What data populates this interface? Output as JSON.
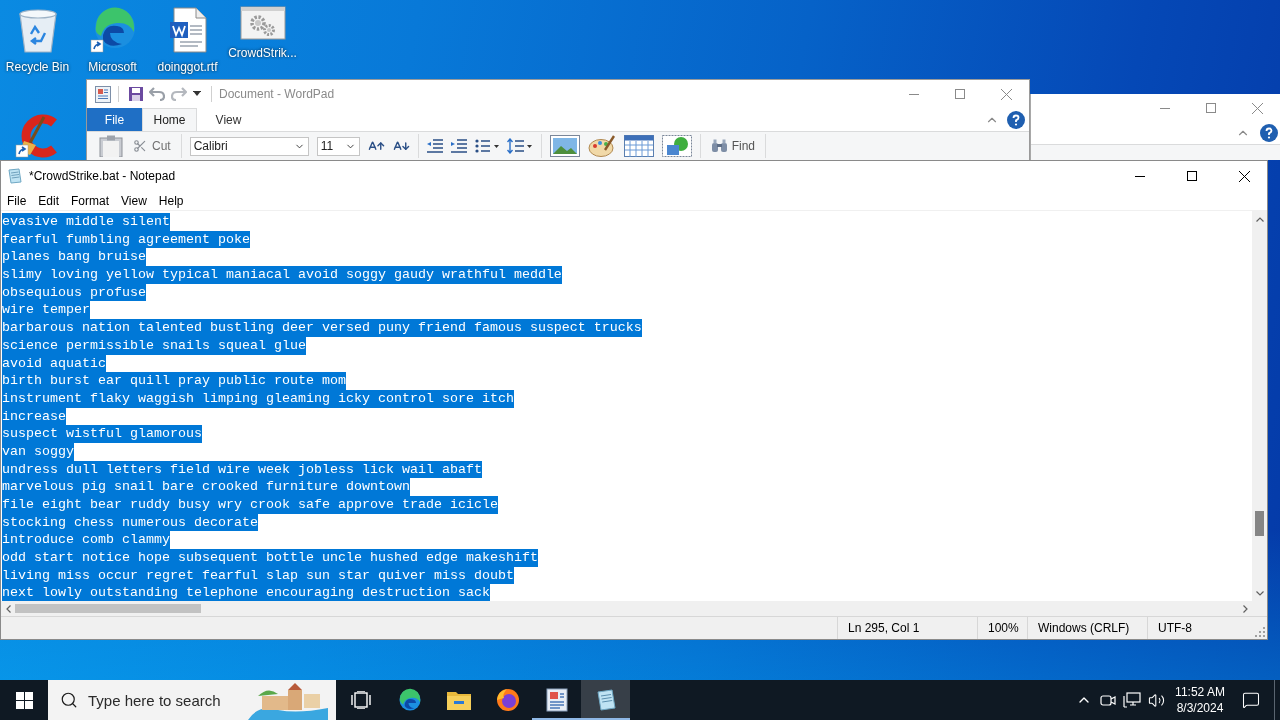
{
  "desktop": {
    "icons": [
      {
        "kind": "recycle-bin",
        "label": "Recycle Bin"
      },
      {
        "kind": "browser",
        "label": "Microsoft"
      },
      {
        "kind": "document",
        "label": "doinggot.rtf"
      },
      {
        "kind": "batch-file",
        "label": "CrowdStrik..."
      },
      {
        "kind": "cleaner"
      }
    ]
  },
  "wordpad": {
    "title": "Document - WordPad",
    "tabs": [
      {
        "kind": "menu",
        "label": "File",
        "selected": false
      },
      {
        "kind": "tab",
        "label": "Home",
        "selected": true
      },
      {
        "kind": "tab",
        "label": "View",
        "selected": false
      }
    ],
    "cut": "Cut",
    "font_name": "Calibri",
    "font_size": "11",
    "find": "Find"
  },
  "notepad": {
    "title": "*CrowdStrike.bat - Notepad",
    "menu": [
      "File",
      "Edit",
      "Format",
      "View",
      "Help"
    ],
    "lines": [
      {
        "text": "evasive middle silent",
        "selected": true
      },
      {
        "text": "fearful fumbling agreement poke",
        "selected": true
      },
      {
        "text": "planes bang bruise",
        "selected": true
      },
      {
        "text": "slimy loving yellow typical maniacal avoid soggy gaudy wrathful meddle",
        "selected": true
      },
      {
        "text": "obsequious profuse",
        "selected": true
      },
      {
        "text": "wire temper",
        "selected": true
      },
      {
        "text": "barbarous nation talented bustling deer versed puny friend famous suspect trucks",
        "selected": true
      },
      {
        "text": "science permissible snails squeal glue",
        "selected": true
      },
      {
        "text": "avoid aquatic",
        "selected": true
      },
      {
        "text": "birth burst ear quill pray public route mom",
        "selected": true
      },
      {
        "text": "instrument flaky waggish limping gleaming icky control sore itch",
        "selected": true
      },
      {
        "text": "increase",
        "selected": true
      },
      {
        "text": "suspect wistful glamorous",
        "selected": true
      },
      {
        "text": "van soggy",
        "selected": true
      },
      {
        "text": "undress dull letters field wire week jobless lick wail abaft",
        "selected": true
      },
      {
        "text": "marvelous pig snail bare crooked furniture downtown",
        "selected": true
      },
      {
        "text": "file eight bear ruddy busy wry crook safe approve trade icicle",
        "selected": true
      },
      {
        "text": "stocking chess numerous decorate",
        "selected": true
      },
      {
        "text": "introduce comb clammy",
        "selected": true
      },
      {
        "text": "odd start notice hope subsequent bottle uncle hushed edge makeshift",
        "selected": true
      },
      {
        "text": "living miss occur regret fearful slap sun star quiver miss doubt",
        "selected": true
      },
      {
        "text": "next lowly outstanding telephone encouraging destruction sack",
        "selected": true
      }
    ],
    "status_bar": [
      "Ln 295, Col 1",
      "100%",
      "Windows (CRLF)",
      "UTF-8"
    ]
  },
  "taskbar": {
    "search": {
      "placeholder": "Type here to search"
    },
    "apps": [
      {
        "kind": "browser",
        "running": false,
        "selected": false
      },
      {
        "kind": "folder",
        "running": false,
        "selected": false
      },
      {
        "kind": "firefox",
        "running": false,
        "selected": false
      },
      {
        "kind": "wordpad",
        "running": true,
        "selected": false
      },
      {
        "kind": "notepad",
        "running": true,
        "selected": true
      }
    ],
    "clock": {
      "time": "11:52 AM",
      "date": "8/3/2024"
    }
  }
}
